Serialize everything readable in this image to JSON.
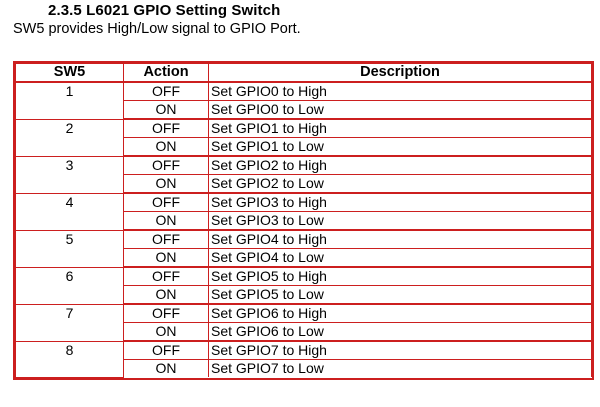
{
  "section": {
    "heading": "2.3.5 L6021 GPIO Setting Switch",
    "subtitle": "SW5 provides High/Low signal to GPIO Port."
  },
  "table": {
    "headers": [
      "SW5",
      "Action",
      "Description"
    ],
    "groups": [
      {
        "sw": "1",
        "rows": [
          {
            "action": "OFF",
            "desc": "Set GPIO0 to High"
          },
          {
            "action": "ON",
            "desc": "Set GPIO0 to Low"
          }
        ]
      },
      {
        "sw": "2",
        "rows": [
          {
            "action": "OFF",
            "desc": "Set GPIO1 to High"
          },
          {
            "action": "ON",
            "desc": "Set GPIO1 to Low"
          }
        ]
      },
      {
        "sw": "3",
        "rows": [
          {
            "action": "OFF",
            "desc": "Set GPIO2 to High"
          },
          {
            "action": "ON",
            "desc": "Set GPIO2 to Low"
          }
        ]
      },
      {
        "sw": "4",
        "rows": [
          {
            "action": "OFF",
            "desc": "Set GPIO3 to High"
          },
          {
            "action": "ON",
            "desc": "Set GPIO3 to Low"
          }
        ]
      },
      {
        "sw": "5",
        "rows": [
          {
            "action": "OFF",
            "desc": "Set GPIO4 to High"
          },
          {
            "action": "ON",
            "desc": "Set GPIO4 to Low"
          }
        ]
      },
      {
        "sw": "6",
        "rows": [
          {
            "action": "OFF",
            "desc": "Set GPIO5 to High"
          },
          {
            "action": "ON",
            "desc": "Set GPIO5 to Low"
          }
        ]
      },
      {
        "sw": "7",
        "rows": [
          {
            "action": "OFF",
            "desc": "Set GPIO6 to High"
          },
          {
            "action": "ON",
            "desc": "Set GPIO6 to Low"
          }
        ]
      },
      {
        "sw": "8",
        "rows": [
          {
            "action": "OFF",
            "desc": "Set GPIO7 to High"
          },
          {
            "action": "ON",
            "desc": "Set GPIO7 to Low"
          }
        ]
      }
    ]
  },
  "colors": {
    "table_border": "#cc1f1f"
  }
}
